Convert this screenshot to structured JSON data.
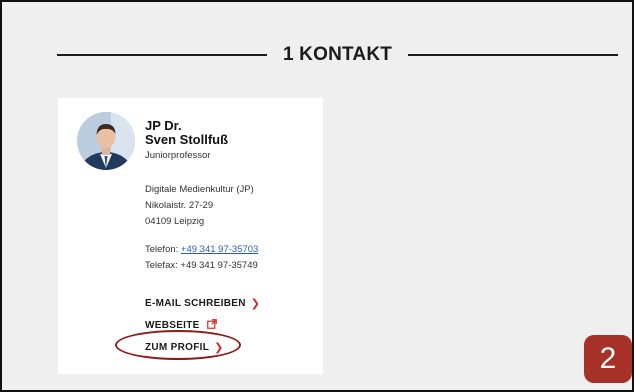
{
  "section": {
    "title": "1 KONTAKT"
  },
  "contact": {
    "name_line1": "JP Dr.",
    "name_line2": "Sven Stollfuß",
    "role": "Juniorprofessor",
    "address": [
      "Digitale Medienkultur (JP)",
      "Nikolaistr. 27-29",
      "04109 Leipzig"
    ],
    "phone_label": "Telefon:",
    "phone_value": "+49 341 97-35703",
    "fax_label": "Telefax:",
    "fax_value": "+49 341 97-35749"
  },
  "links": {
    "email": "E-MAIL SCHREIBEN",
    "website": "WEBSEITE",
    "profile": "ZUM PROFIL"
  },
  "annotation": {
    "step": "2"
  },
  "colors": {
    "accent_red": "#c5302c",
    "annotation_red": "#a63127",
    "link_blue": "#2a5db0",
    "background": "#efefef"
  }
}
